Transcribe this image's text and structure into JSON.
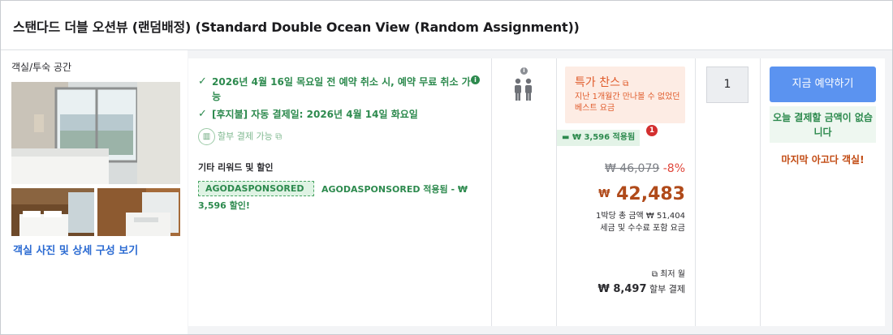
{
  "room": {
    "title": "스탠다드 더블 오션뷰 (랜덤배정) (Standard Double Ocean View (Random Assignment))",
    "category": "객실/투숙 공간",
    "photos_link": "객실 사진 및 상세 구성 보기"
  },
  "policy": {
    "cancel": "2026년 4월 16일 목요일 전 예약 취소 시, 예약 무료 취소 가능",
    "postpaid": "[후지불] 자동 결제일: 2026년 4월 14일 화요일",
    "installment": "할부 결제 가능",
    "rewards_title": "기타 리워드 및 할인",
    "promo_tag": "AGODASPONSORED",
    "promo_text": "AGODASPONSORED 적용됨 - ₩ 3,596 할인!"
  },
  "price": {
    "sale_title": "특가 찬스",
    "sale_subtitle": "지난 1개월간 만나볼 수 없었던 베스트 요금",
    "coupon": "₩ 3,596 적용됨",
    "coupon_badge": "1",
    "original": "₩ 46,079",
    "discount": "-8%",
    "currency": "₩",
    "final": "42,483",
    "per_night": "1박당 총 금액 ₩ 51,404",
    "tax_note": "세금 및 수수료 포함 요금",
    "monthly_label": "최저 월",
    "monthly_value": "₩ 8,497",
    "monthly_suffix": "할부 결제"
  },
  "quantity": "1",
  "booking": {
    "button": "지금 예약하기",
    "no_payment": "오늘 결제할 금액이 없습니다",
    "last_room": "마지막 아고다 객실!"
  },
  "colors": {
    "accent_green": "#2d8a4e",
    "sale_orange": "#e05b2b",
    "price_brown": "#b04a1a",
    "book_blue": "#5b93f0"
  }
}
